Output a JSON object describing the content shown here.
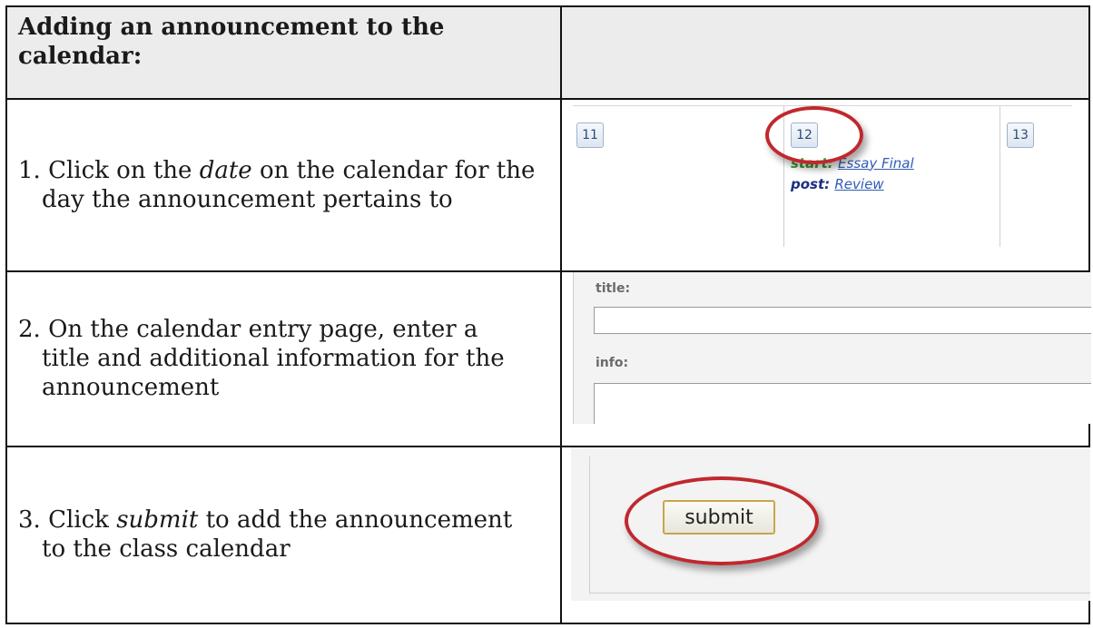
{
  "header": {
    "title": "Adding an announcement to the calendar:"
  },
  "steps": [
    {
      "number": "1.",
      "text_before": "Click on the ",
      "emphasis": "date",
      "text_after": " on the calendar for the",
      "line2": "day the announcement pertains to"
    },
    {
      "number": "2.",
      "line1": "On the calendar entry page, enter a",
      "line2": "title and additional information for the",
      "line3": "announcement"
    },
    {
      "number": "3.",
      "text_before": "Click ",
      "emphasis": "submit",
      "text_after": " to add the announcement",
      "line2": "to the class calendar"
    }
  ],
  "calendar_shot": {
    "days": [
      "11",
      "12",
      "13"
    ],
    "start_label": "start:",
    "start_link": "Essay Final",
    "post_label": "post:",
    "post_link": "Review",
    "highlight_color": "#c0282e"
  },
  "form_shot": {
    "title_label": "title:",
    "title_value": "",
    "info_label": "info:",
    "info_value": ""
  },
  "submit_shot": {
    "button_label": "submit"
  }
}
